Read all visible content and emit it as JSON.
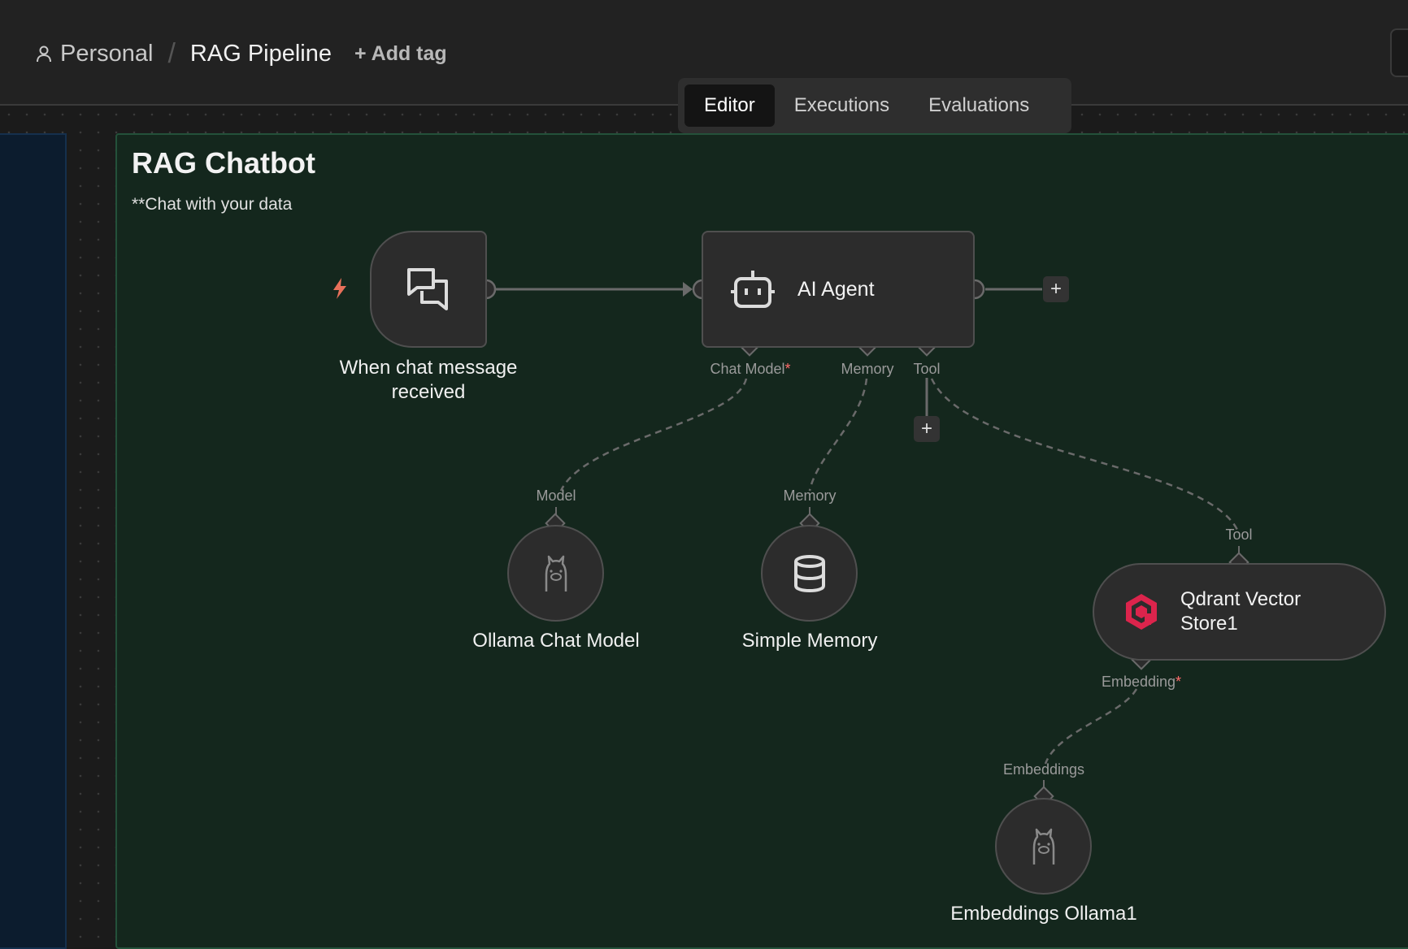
{
  "header": {
    "breadcrumb_personal": "Personal",
    "breadcrumb_separator": "/",
    "workflow_name": "RAG Pipeline",
    "add_tag_label": "+ Add tag"
  },
  "tabs": [
    {
      "label": "Editor",
      "active": true
    },
    {
      "label": "Executions",
      "active": false
    },
    {
      "label": "Evaluations",
      "active": false
    }
  ],
  "sticky_note": {
    "title": "RAG Chatbot",
    "text": "**Chat with your data"
  },
  "nodes": {
    "trigger": {
      "label_line1": "When chat message",
      "label_line2": "received",
      "icon": "chat-bubbles-icon"
    },
    "agent": {
      "label": "AI Agent",
      "icon": "robot-icon"
    },
    "chat_model": {
      "label": "Ollama Chat Model",
      "icon": "llama-icon"
    },
    "memory": {
      "label": "Simple Memory",
      "icon": "database-icon"
    },
    "vector_store": {
      "label_line1": "Qdrant Vector",
      "label_line2": "Store1",
      "icon": "qdrant-icon"
    },
    "embeddings": {
      "label": "Embeddings Ollama1",
      "icon": "llama-icon"
    }
  },
  "ports": {
    "agent_chat_model": "Chat Model",
    "agent_memory": "Memory",
    "agent_tool": "Tool",
    "required_marker": "*",
    "model_input": "Model",
    "memory_input": "Memory",
    "tool_input": "Tool",
    "vector_embedding": "Embedding",
    "embeddings_input": "Embeddings"
  },
  "buttons": {
    "add_node": "+"
  },
  "colors": {
    "trigger_bolt": "#e8705a",
    "required": "#ff6b6b",
    "sticky_green_bg": "#14271d",
    "sticky_blue_bg": "#0c1c2e",
    "qdrant": "#dc244c"
  }
}
